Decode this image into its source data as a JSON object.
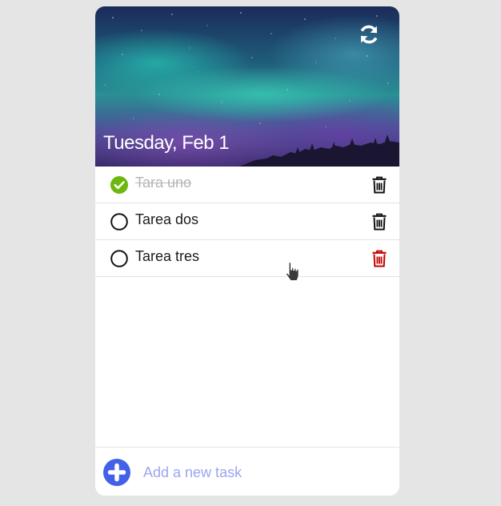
{
  "header": {
    "date": "Tuesday, Feb 1",
    "refresh_icon": "refresh-icon"
  },
  "tasks": [
    {
      "label": "Tara uno",
      "completed": true
    },
    {
      "label": "Tarea dos",
      "completed": false
    },
    {
      "label": "Tarea tres",
      "completed": false,
      "delete_hovered": true
    }
  ],
  "footer": {
    "placeholder": "Add a new task",
    "value": ""
  },
  "colors": {
    "check_done": "#6cb80c",
    "accent": "#4361e8",
    "delete_hover": "#c40000",
    "placeholder": "#9aa6f0"
  }
}
